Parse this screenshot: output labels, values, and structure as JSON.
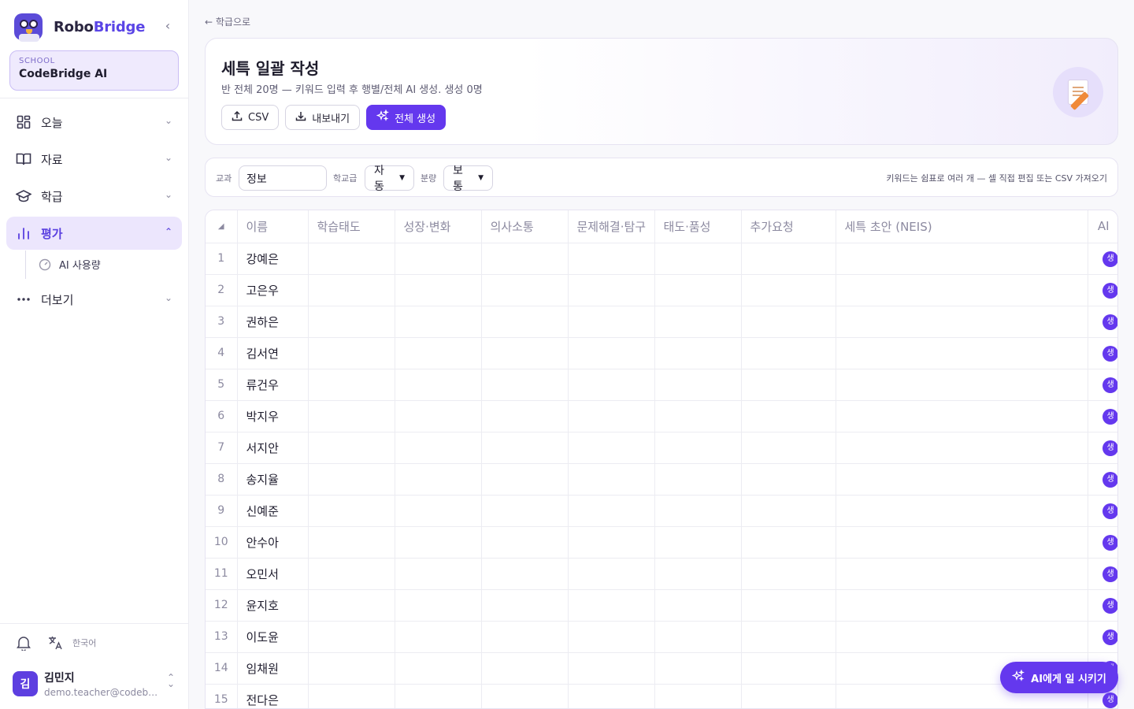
{
  "brand": {
    "name_main": "Robo",
    "name_accent": "Bridge"
  },
  "school": {
    "label": "SCHOOL",
    "name": "CodeBridge AI"
  },
  "nav": {
    "items": [
      {
        "label": "오늘",
        "icon": "grid-icon"
      },
      {
        "label": "자료",
        "icon": "book-icon"
      },
      {
        "label": "학급",
        "icon": "graduation-cap-icon"
      },
      {
        "label": "평가",
        "icon": "bar-chart-icon"
      }
    ],
    "sub_item": {
      "label": "AI 사용량",
      "icon": "gauge-icon"
    },
    "more": {
      "label": "더보기",
      "icon": "more-icon"
    }
  },
  "bottom": {
    "language": "한국어",
    "user": {
      "initial": "김",
      "name": "김민지",
      "email": "demo.teacher@codebridge.ai"
    }
  },
  "back_link": "← 학급으로",
  "hero": {
    "title": "세특 일괄 작성",
    "subtitle": "반 전체 20명 — 키워드 입력 후 행별/전체 AI 생성. 생성 0명",
    "buttons": {
      "csv": "CSV",
      "export": "내보내기",
      "generate_all": "전체 생성"
    }
  },
  "filters": {
    "subject_label": "교과",
    "subject_value": "정보",
    "level_label": "학교급",
    "level_value": "자동",
    "length_label": "분량",
    "length_value": "보통",
    "hint": "키워드는 쉼표로 여러 개 — 셀 직접 편집 또는 CSV 가져오기"
  },
  "table": {
    "columns": [
      "이름",
      "학습태도",
      "성장·변화",
      "의사소통",
      "문제해결·탐구",
      "태도·품성",
      "추가요청",
      "세특 초안 (NEIS)",
      "AI"
    ],
    "row_action_label": "생",
    "rows": [
      {
        "no": "1",
        "name": "강예은"
      },
      {
        "no": "2",
        "name": "고은우"
      },
      {
        "no": "3",
        "name": "권하은"
      },
      {
        "no": "4",
        "name": "김서연"
      },
      {
        "no": "5",
        "name": "류건우"
      },
      {
        "no": "6",
        "name": "박지우"
      },
      {
        "no": "7",
        "name": "서지안"
      },
      {
        "no": "8",
        "name": "송지율"
      },
      {
        "no": "9",
        "name": "신예준"
      },
      {
        "no": "10",
        "name": "안수아"
      },
      {
        "no": "11",
        "name": "오민서"
      },
      {
        "no": "12",
        "name": "윤지호"
      },
      {
        "no": "13",
        "name": "이도윤"
      },
      {
        "no": "14",
        "name": "임채원"
      },
      {
        "no": "15",
        "name": "전다은"
      }
    ]
  },
  "fab": {
    "label": "AI에게 일 시키기"
  },
  "colors": {
    "accent": "#6438ee",
    "active_bg": "#ece6fd"
  }
}
